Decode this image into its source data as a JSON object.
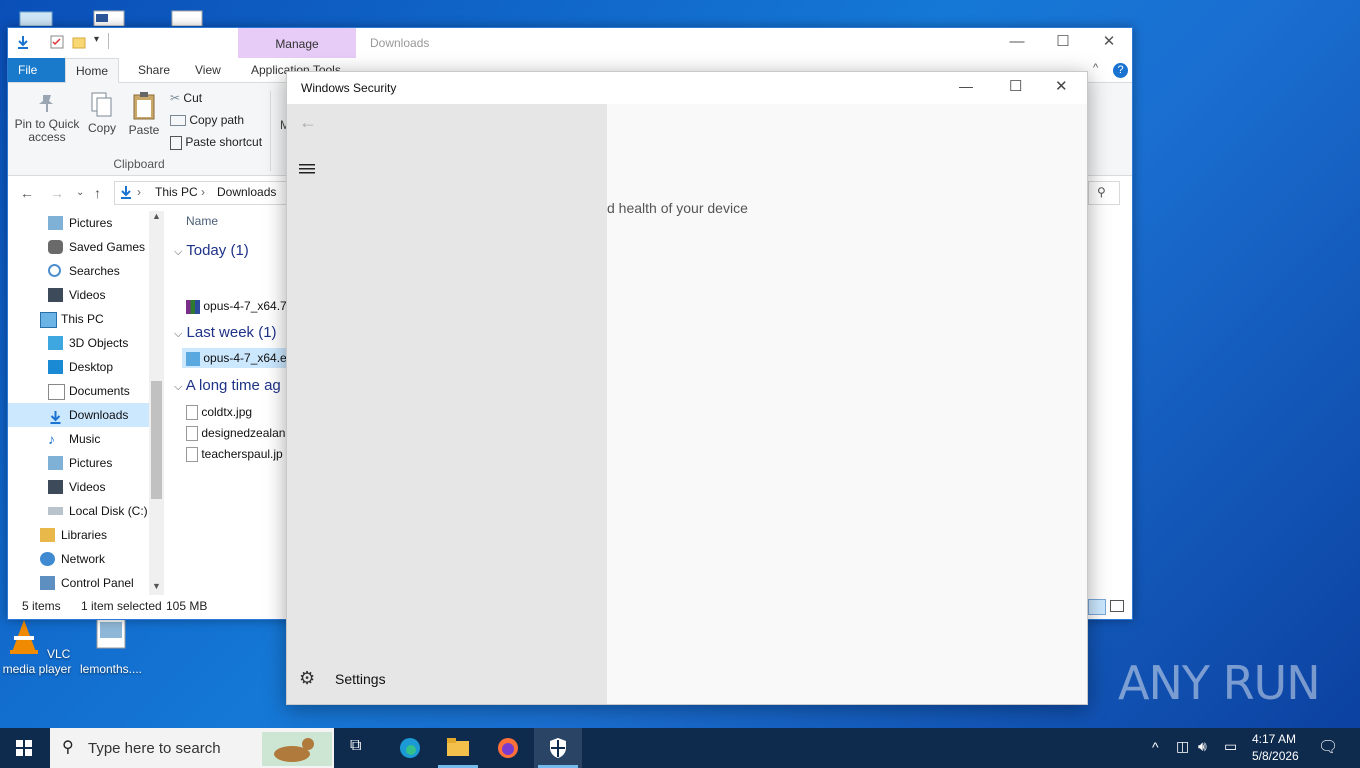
{
  "desktop": {
    "icons": [
      {
        "label": "VLC media player"
      },
      {
        "label": "lemonths...."
      }
    ],
    "watermark": "ANY RUN"
  },
  "explorer": {
    "manage_tab": "Manage",
    "title": "Downloads",
    "tabs": {
      "file": "File",
      "home": "Home",
      "share": "Share",
      "view": "View",
      "app_tools": "Application Tools"
    },
    "ribbon": {
      "pin": "Pin to Quick access",
      "copy": "Copy",
      "paste": "Paste",
      "cut": "Cut",
      "copy_path": "Copy path",
      "paste_shortcut": "Paste shortcut",
      "group_clipboard": "Clipboard",
      "partial_m": "M"
    },
    "breadcrumb": {
      "this_pc": "This PC",
      "downloads": "Downloads"
    },
    "tree": [
      {
        "label": "Pictures",
        "icon": "pictures-icon"
      },
      {
        "label": "Saved Games",
        "icon": "saved-games-icon"
      },
      {
        "label": "Searches",
        "icon": "search-icon"
      },
      {
        "label": "Videos",
        "icon": "videos-icon"
      },
      {
        "label": "This PC",
        "icon": "computer-icon"
      },
      {
        "label": "3D Objects",
        "icon": "cube-icon"
      },
      {
        "label": "Desktop",
        "icon": "desktop-icon"
      },
      {
        "label": "Documents",
        "icon": "documents-icon"
      },
      {
        "label": "Downloads",
        "icon": "download-icon"
      },
      {
        "label": "Music",
        "icon": "music-icon"
      },
      {
        "label": "Pictures",
        "icon": "pictures-icon"
      },
      {
        "label": "Videos",
        "icon": "videos-icon"
      },
      {
        "label": "Local Disk (C:)",
        "icon": "disk-icon"
      },
      {
        "label": "Libraries",
        "icon": "library-icon"
      },
      {
        "label": "Network",
        "icon": "network-icon"
      },
      {
        "label": "Control Panel",
        "icon": "control-panel-icon"
      }
    ],
    "column_name": "Name",
    "groups": {
      "today": "Today (1)",
      "last_week": "Last week (1)",
      "long_ago": "A long time ag"
    },
    "files": {
      "today_file": "opus-4-7_x64.7",
      "last_week_file": "opus-4-7_x64.e",
      "old1": "coldtx.jpg",
      "old2": "designedzealan",
      "old3": "teacherspaul.jp"
    },
    "status": {
      "items": "5 items",
      "selected": "1 item selected",
      "size": "105 MB"
    }
  },
  "security": {
    "title": "Windows Security",
    "main_text": "d health of your device",
    "settings": "Settings"
  },
  "taskbar": {
    "search_placeholder": "Type here to search",
    "time": "4:17 AM",
    "date": "5/8/2026"
  }
}
